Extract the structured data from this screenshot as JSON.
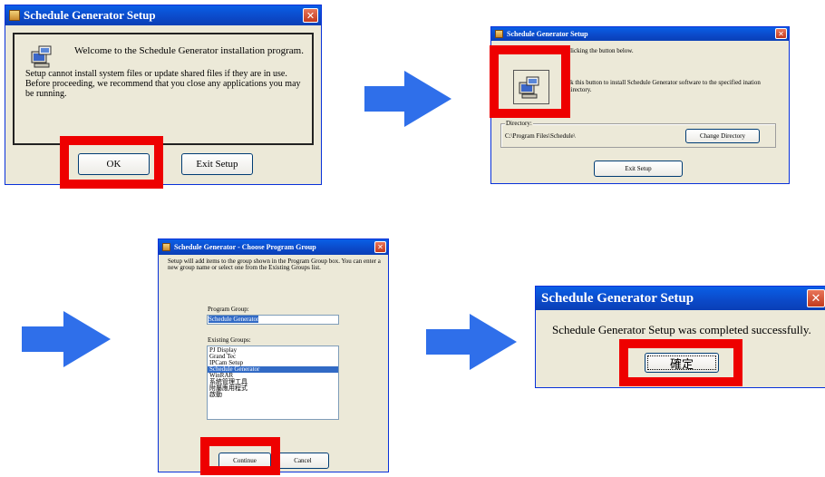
{
  "dialog1": {
    "title": "Schedule Generator Setup",
    "welcome": "Welcome to the Schedule Generator installation program.",
    "message": "Setup cannot install system files or update shared files if they are in use.  Before proceeding, we recommend that you close any applications you may be running.",
    "ok_label": "OK",
    "exit_label": "Exit Setup",
    "close_glyph": "✕",
    "installer_icon": "computer-installer-icon"
  },
  "dialog2": {
    "title": "Schedule Generator Setup",
    "heading": "clicking the button below.",
    "instruction": "ck this button to install Schedule Generator software to the specified ination directory.",
    "directory_label": "Directory:",
    "directory_value": "C:\\Program Files\\Schedule\\",
    "change_label": "Change Directory",
    "exit_label": "Exit Setup",
    "close_glyph": "✕",
    "installer_icon": "computer-installer-icon"
  },
  "dialog3": {
    "title": "Schedule Generator - Choose Program Group",
    "message": "Setup will add items to the group shown in the Program Group box. You can enter a new group name or select one from the Existing Groups list.",
    "program_group_label": "Program Group:",
    "program_group_value": "Schedule Generator",
    "existing_groups_label": "Existing Groups:",
    "existing_groups": [
      "PJ Display",
      "Grand Tec",
      "IPCam Setup",
      "Schedule Generator",
      "WinRAR",
      "系統管理工具",
      "附屬應用程式",
      "啟動"
    ],
    "selected_group_index": 3,
    "continue_label": "Continue",
    "cancel_label": "Cancel",
    "close_glyph": "✕"
  },
  "dialog4": {
    "title": "Schedule Generator Setup",
    "message": "Schedule Generator Setup was completed successfully.",
    "ok_label": "確定",
    "close_glyph": "✕"
  },
  "colors": {
    "highlight": "#ee0000",
    "arrow": "#2f6fea",
    "title_bar": "#0b49c8",
    "selection": "#316ac5"
  },
  "icons": [
    "arrow-right-icon"
  ]
}
